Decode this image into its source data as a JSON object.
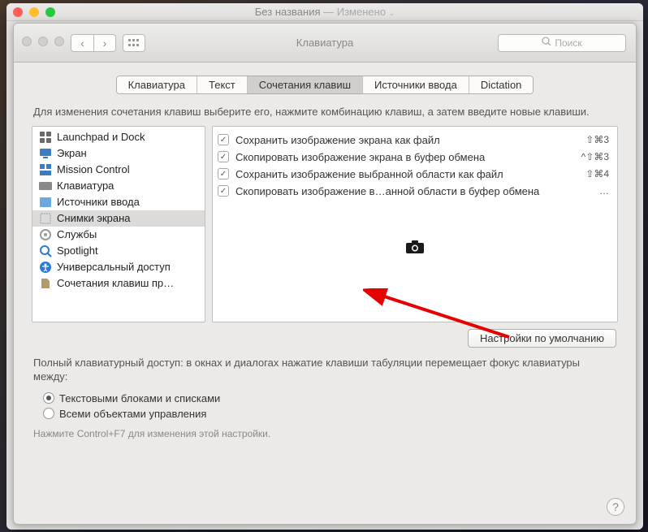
{
  "outer_window": {
    "title": "Без названия",
    "changed": "— Изменено"
  },
  "toolbar": {
    "title": "Клавиатура",
    "search_placeholder": "Поиск"
  },
  "tabs": {
    "items": [
      "Клавиатура",
      "Текст",
      "Сочетания клавиш",
      "Источники ввода",
      "Dictation"
    ],
    "active_index": 2
  },
  "instruction": "Для изменения сочетания клавиш выберите его, нажмите комбинацию клавиш, а затем введите новые клавиши.",
  "sidebar": {
    "items": [
      {
        "label": "Launchpad и Dock",
        "icon": "launchpad",
        "color": "#6b6b6b"
      },
      {
        "label": "Экран",
        "icon": "display",
        "color": "#3a7ec1"
      },
      {
        "label": "Mission Control",
        "icon": "mission",
        "color": "#3a7ec1"
      },
      {
        "label": "Клавиатура",
        "icon": "keyboard",
        "color": "#8a8a8a"
      },
      {
        "label": "Источники ввода",
        "icon": "input",
        "color": "#6aa8dd"
      },
      {
        "label": "Снимки экрана",
        "icon": "screenshot",
        "color": "#9a9a9a"
      },
      {
        "label": "Службы",
        "icon": "services",
        "color": "#9a9a9a"
      },
      {
        "label": "Spotlight",
        "icon": "spotlight",
        "color": "#2a7ad6"
      },
      {
        "label": "Универсальный доступ",
        "icon": "accessibility",
        "color": "#2a7ad6"
      },
      {
        "label": "Сочетания клавиш пр…",
        "icon": "app",
        "color": "#b19a6b"
      }
    ],
    "selected_index": 5
  },
  "shortcuts": [
    {
      "checked": true,
      "label": "Сохранить изображение экрана как файл",
      "keys": "⇧⌘3"
    },
    {
      "checked": true,
      "label": "Скопировать изображение экрана в буфер обмена",
      "keys": "^⇧⌘3"
    },
    {
      "checked": true,
      "label": "Сохранить изображение выбранной области как файл",
      "keys": "⇧⌘4"
    },
    {
      "checked": true,
      "label": "Скопировать изображение в…анной области в буфер обмена",
      "keys": "…"
    }
  ],
  "defaults_button": "Настройки по умолчанию",
  "access_text": "Полный клавиатурный доступ: в окнах и диалогах нажатие клавиши табуляции перемещает фокус клавиатуры между:",
  "radios": {
    "items": [
      "Текстовыми блоками и списками",
      "Всеми объектами управления"
    ],
    "checked_index": 0
  },
  "hint": "Нажмите Control+F7 для изменения этой настройки.",
  "help_label": "?"
}
